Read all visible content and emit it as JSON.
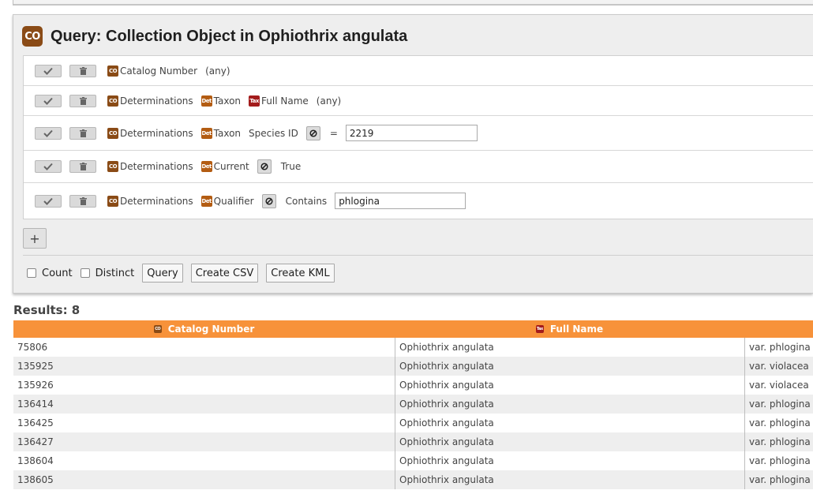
{
  "query": {
    "icon": "CO",
    "title": "Query: Collection Object in Ophiothrix angulata",
    "fields": [
      {
        "path": [
          {
            "icon": "CO",
            "label": "Catalog Number"
          }
        ],
        "operator": "",
        "op_label": "(any)",
        "value": "",
        "value_type": "label"
      },
      {
        "path": [
          {
            "icon": "CO",
            "label": "Determinations"
          },
          {
            "icon": "Det",
            "label": "Taxon"
          },
          {
            "icon": "Tax",
            "label": "Full Name"
          }
        ],
        "operator": "",
        "op_label": "(any)",
        "value": "",
        "value_type": "label"
      },
      {
        "path": [
          {
            "icon": "CO",
            "label": "Determinations"
          },
          {
            "icon": "Det",
            "label": "Taxon"
          },
          {
            "icon": "",
            "label": "Species ID"
          }
        ],
        "operator": "not-icon",
        "op_label": "=",
        "value": "2219",
        "value_type": "input"
      },
      {
        "path": [
          {
            "icon": "CO",
            "label": "Determinations"
          },
          {
            "icon": "Det",
            "label": "Current"
          }
        ],
        "operator": "not-icon",
        "op_label": "",
        "value": "True",
        "value_type": "text"
      },
      {
        "path": [
          {
            "icon": "CO",
            "label": "Determinations"
          },
          {
            "icon": "Det",
            "label": "Qualifier"
          }
        ],
        "operator": "not-icon",
        "op_label": "Contains",
        "value": "phlogina",
        "value_type": "input"
      }
    ],
    "add_button": "+",
    "options": {
      "count": "Count",
      "distinct": "Distinct"
    },
    "buttons": {
      "query": "Query",
      "csv": "Create CSV",
      "kml": "Create KML"
    }
  },
  "results": {
    "label": "Results: 8",
    "headers": [
      {
        "icon": "CO",
        "label": "Catalog Number"
      },
      {
        "icon": "Tax",
        "label": "Full Name"
      },
      {
        "icon": "",
        "label": ""
      }
    ],
    "rows": [
      [
        "75806",
        "Ophiothrix angulata",
        "var. phlogina"
      ],
      [
        "135925",
        "Ophiothrix angulata",
        "var. violacea"
      ],
      [
        "135926",
        "Ophiothrix angulata",
        "var. violacea"
      ],
      [
        "136414",
        "Ophiothrix angulata",
        "var. phlogina"
      ],
      [
        "136425",
        "Ophiothrix angulata",
        "var. phlogina"
      ],
      [
        "136427",
        "Ophiothrix angulata",
        "var. phlogina"
      ],
      [
        "138604",
        "Ophiothrix angulata",
        "var. phlogina"
      ],
      [
        "138605",
        "Ophiothrix angulata",
        "var. phlogina"
      ]
    ]
  },
  "colors": {
    "header_orange": "#f7923a",
    "co_brown": "#8a4b16",
    "det_orange": "#b35c12",
    "tax_red": "#a31c1c"
  }
}
